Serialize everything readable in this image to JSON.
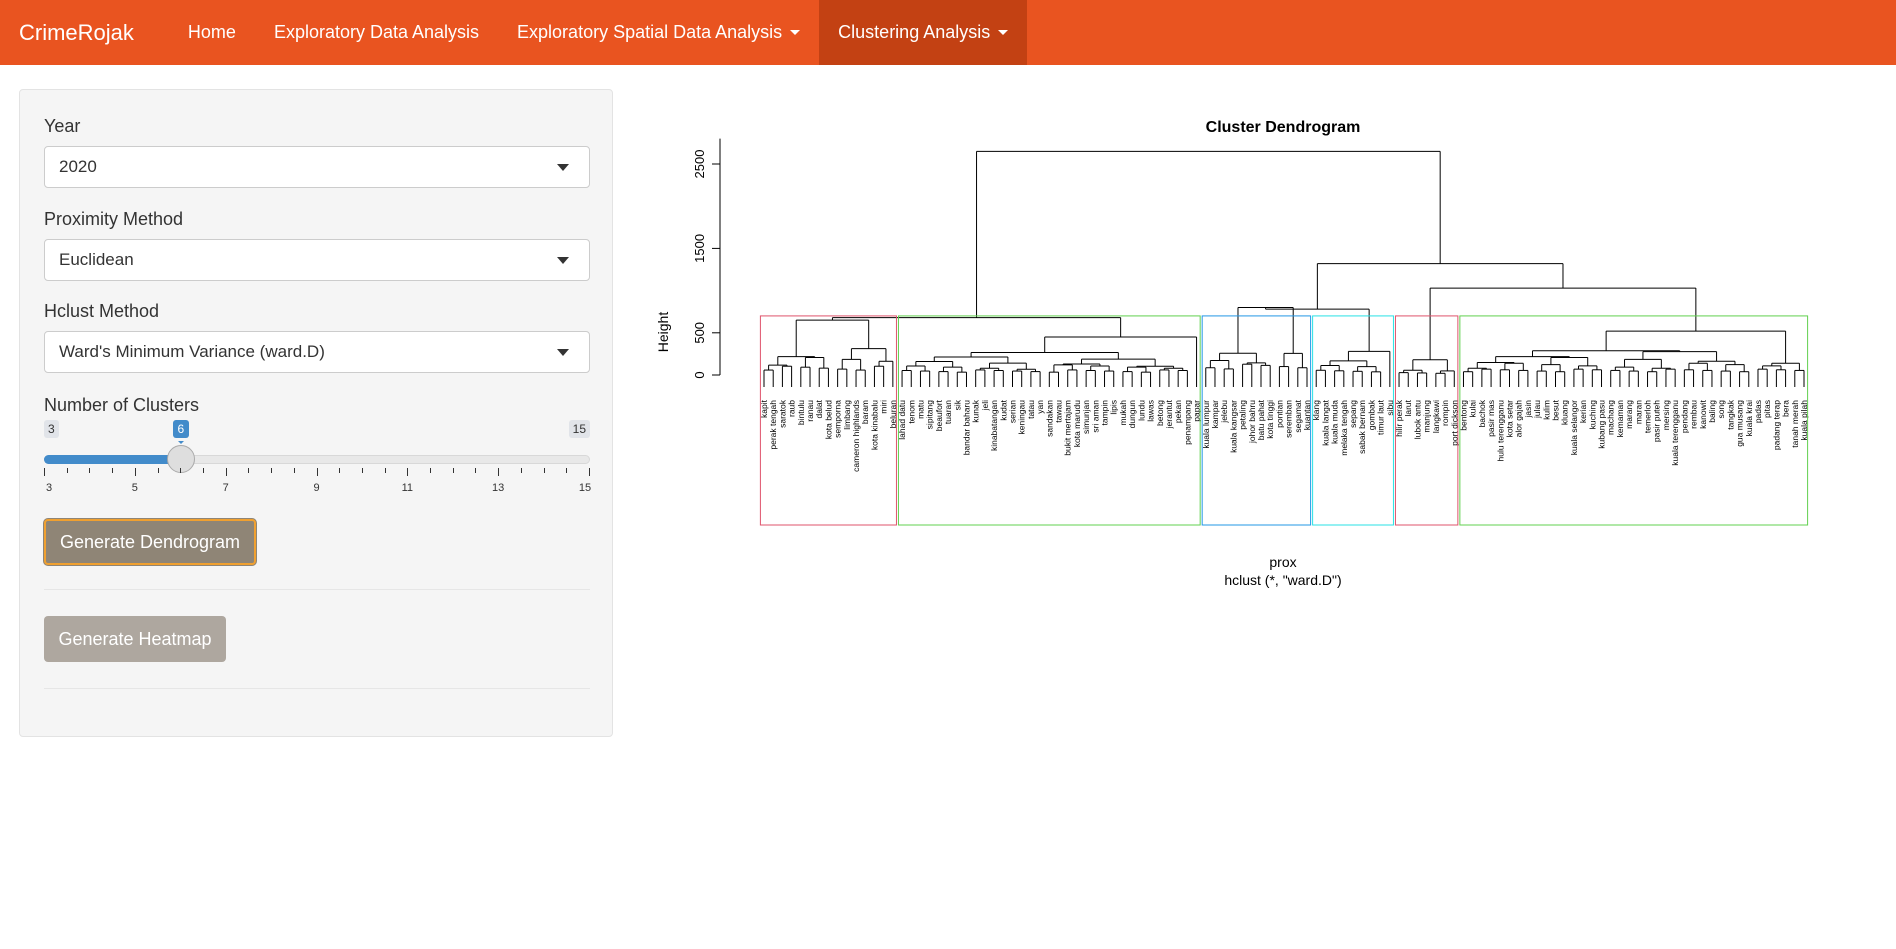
{
  "app": {
    "brand": "CrimeRojak"
  },
  "nav": {
    "items": [
      {
        "label": "Home",
        "dropdown": false,
        "active": false
      },
      {
        "label": "Exploratory Data Analysis",
        "dropdown": false,
        "active": false
      },
      {
        "label": "Exploratory Spatial Data Analysis",
        "dropdown": true,
        "active": false
      },
      {
        "label": "Clustering Analysis",
        "dropdown": true,
        "active": true
      }
    ],
    "bar_color": "#e95420",
    "active_color": "#c34113"
  },
  "sidebar": {
    "year": {
      "label": "Year",
      "value": "2020"
    },
    "proximity": {
      "label": "Proximity Method",
      "value": "Euclidean"
    },
    "hclust": {
      "label": "Hclust Method",
      "value": "Ward's Minimum Variance (ward.D)"
    },
    "clusters": {
      "label": "Number of Clusters",
      "min": "3",
      "max": "15",
      "value": "6",
      "ticks": [
        "3",
        "5",
        "7",
        "9",
        "11",
        "13",
        "15"
      ]
    },
    "generate_dendrogram": "Generate Dendrogram",
    "generate_heatmap": "Generate Heatmap"
  },
  "chart_data": {
    "type": "dendrogram",
    "title": "Cluster Dendrogram",
    "ylabel": "Height",
    "xlabel": "prox",
    "sub": "hclust (*, \"ward.D\")",
    "ylim": [
      0,
      2800
    ],
    "yticks": [
      0,
      500,
      1500,
      2500
    ],
    "k": 6,
    "root_height": 2650,
    "clusters": [
      {
        "color": "#DF536B",
        "merge_height": 650,
        "labels": [
          "kapit",
          "perak tengah",
          "saratok",
          "raub",
          "bintulu",
          "ranau",
          "dalat",
          "kota belud",
          "semporna",
          "limbang",
          "cameron highlands",
          "baram",
          "kota kinabalu",
          "miri",
          "beluran"
        ]
      },
      {
        "color": "#61D04F",
        "merge_height": 450,
        "labels": [
          "lahad datu",
          "tenom",
          "matu",
          "sipitang",
          "beaufort",
          "tuaran",
          "sik",
          "bandar baharu",
          "kunak",
          "jeli",
          "kinabatangan",
          "kudat",
          "serian",
          "keningau",
          "tatau",
          "yan",
          "sandakan",
          "tawau",
          "bukit mertajam",
          "kota marudu",
          "simunjan",
          "sri aman",
          "tampin",
          "lipis",
          "mukah",
          "dungun",
          "lundu",
          "lawas",
          "betong",
          "jerantut",
          "pekan",
          "penampang",
          "papar"
        ]
      },
      {
        "color": "#2297E6",
        "merge_height": 800,
        "labels": [
          "kuala lumpur",
          "kampar",
          "jelebu",
          "kuala kangsar",
          "petaling",
          "johor bahru",
          "batu pahat",
          "kota tinggi",
          "pontian",
          "seremban",
          "segamat",
          "kuantan"
        ]
      },
      {
        "color": "#28E2E5",
        "merge_height": 280,
        "labels": [
          "klang",
          "kuala langat",
          "kuala muda",
          "melaka tengah",
          "sepang",
          "sabak bernam",
          "gombak",
          "timur laut",
          "sibu"
        ]
      },
      {
        "color": "#DF536B",
        "merge_height": 180,
        "labels": [
          "hilir perak",
          "larut",
          "lubok antu",
          "manjung",
          "langkawi",
          "rompin",
          "port dickson"
        ]
      },
      {
        "color": "#61D04F",
        "merge_height": 520,
        "labels": [
          "bentong",
          "kulai",
          "bachok",
          "pasir mas",
          "hulu terengganu",
          "kota setar",
          "alor gajah",
          "jasin",
          "julau",
          "kulim",
          "besut",
          "kluang",
          "kuala selangor",
          "kerian",
          "kuching",
          "kubang pasu",
          "machang",
          "kemaman",
          "marang",
          "maran",
          "temerloh",
          "pasir puteh",
          "mersing",
          "kuala terengganu",
          "pendang",
          "rembau",
          "kanowit",
          "baling",
          "song",
          "tangkak",
          "gua musang",
          "kuala krai",
          "padas",
          "pitas",
          "padang terap",
          "bera",
          "tanah merah",
          "kuala pilah"
        ]
      }
    ],
    "upper_merges": [
      {
        "name": "left",
        "height": 680
      },
      {
        "name": "middle",
        "height": 780
      },
      {
        "name": "right",
        "height": 1030
      },
      {
        "name": "mid-right",
        "height": 1320
      }
    ]
  }
}
